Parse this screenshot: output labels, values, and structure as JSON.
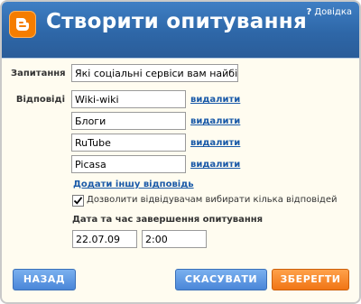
{
  "header": {
    "title": "Створити опитування",
    "help_label": "Довідка",
    "help_icon": "?",
    "logo_icon": "blogger-logo"
  },
  "form": {
    "question_label": "Запитання",
    "question_value": "Які соціальні сервіси вам найбіл",
    "answers_label": "Відповіді",
    "answers": [
      {
        "value": "Wiki-wiki",
        "delete_label": "видалити"
      },
      {
        "value": "Блоги",
        "delete_label": "видалити"
      },
      {
        "value": "RuTube",
        "delete_label": "видалити"
      },
      {
        "value": "Picasa",
        "delete_label": "видалити"
      }
    ],
    "add_answer_label": "Додати іншу відповідь",
    "multi_choice_label": "Дозволити відвідувачам вибирати кілька відповідей",
    "multi_choice_checked": true,
    "end_datetime_label": "Дата та час завершення опитування",
    "end_date": "22.07.09",
    "end_time": "2:00"
  },
  "buttons": {
    "back": "НАЗАД",
    "cancel": "СКАСУВАТИ",
    "save": "ЗБЕРЕГТИ"
  },
  "colors": {
    "header": "#2e67a8",
    "accent_blue": "#4a86d8",
    "accent_orange": "#f07515",
    "link": "#1a5aa8"
  }
}
